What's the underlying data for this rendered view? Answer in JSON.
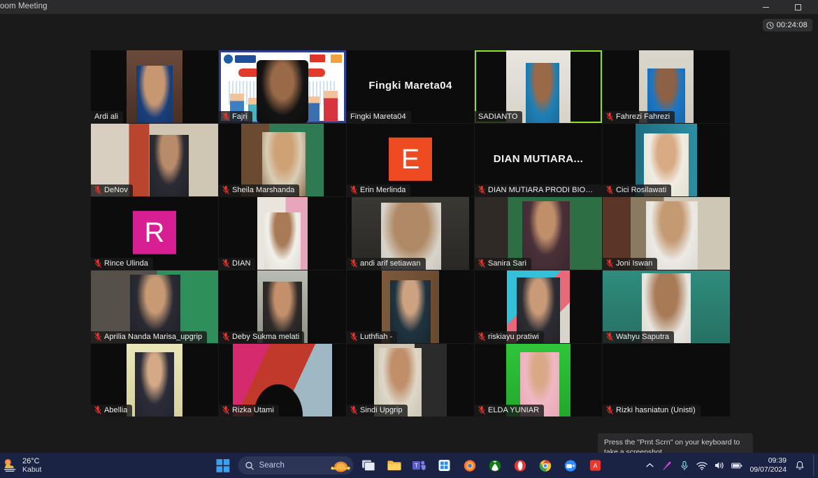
{
  "window": {
    "title": "oom Meeting",
    "minimize_label": "–",
    "maximize_label": "❐"
  },
  "meeting": {
    "timer": "00:24:08",
    "timer_icon": "clock-icon",
    "tooltip": "Press the \"Prnt Scrn\" on your keyboard to take a screenshot"
  },
  "participants": [
    {
      "name": "Ardi ali",
      "muted": false,
      "speaking": false,
      "kind": "video",
      "style": "p-ardi"
    },
    {
      "name": "Fajri",
      "muted": true,
      "speaking": false,
      "kind": "video",
      "style": "p-fajri"
    },
    {
      "name": "Fingki Mareta04",
      "muted": false,
      "speaking": false,
      "kind": "name",
      "display": "Fingki Mareta04"
    },
    {
      "name": "SADIANTO",
      "muted": false,
      "speaking": true,
      "kind": "video",
      "style": "p-sadianto"
    },
    {
      "name": "Fahrezi Fahrezi",
      "muted": true,
      "speaking": false,
      "kind": "video",
      "style": "p-fahrezi"
    },
    {
      "name": "DeNov",
      "muted": true,
      "speaking": false,
      "kind": "video",
      "style": "p-denov"
    },
    {
      "name": "Sheila Marshanda",
      "muted": true,
      "speaking": false,
      "kind": "video",
      "style": "p-sheila"
    },
    {
      "name": "Erin Merlinda",
      "muted": true,
      "speaking": false,
      "kind": "avatar",
      "letter": "E",
      "color": "#ee4b22"
    },
    {
      "name": "DIAN MUTIARA PRODI BIOLOGI F...",
      "muted": true,
      "speaking": false,
      "kind": "name",
      "display": "DIAN  MUTIARA..."
    },
    {
      "name": "Cici Rosilawati",
      "muted": true,
      "speaking": false,
      "kind": "video",
      "style": "p-cici"
    },
    {
      "name": "Rince Ulinda",
      "muted": true,
      "speaking": false,
      "kind": "avatar",
      "letter": "R",
      "color": "#d71f93"
    },
    {
      "name": "DIAN",
      "muted": true,
      "speaking": false,
      "kind": "video",
      "style": "p-dian"
    },
    {
      "name": "andi arif setiawan",
      "muted": true,
      "speaking": false,
      "kind": "video",
      "style": "p-andi"
    },
    {
      "name": "Sanira Sari",
      "muted": true,
      "speaking": false,
      "kind": "video",
      "style": "p-sanira"
    },
    {
      "name": "Joni Iswan",
      "muted": true,
      "speaking": false,
      "kind": "video",
      "style": "p-joni"
    },
    {
      "name": "Aprilia Nanda Marisa_upgrip",
      "muted": true,
      "speaking": false,
      "kind": "video",
      "style": "p-aprilia"
    },
    {
      "name": "Deby Sukma melati",
      "muted": true,
      "speaking": false,
      "kind": "video",
      "style": "p-deby"
    },
    {
      "name": "Luthfiah -",
      "muted": true,
      "speaking": false,
      "kind": "video",
      "style": "p-luthfiah"
    },
    {
      "name": "riskiayu pratiwi",
      "muted": true,
      "speaking": false,
      "kind": "video",
      "style": "p-riskiayu"
    },
    {
      "name": "Wahyu Saputra",
      "muted": true,
      "speaking": false,
      "kind": "video",
      "style": "p-wahyu"
    },
    {
      "name": "Abellia",
      "muted": true,
      "speaking": false,
      "kind": "video",
      "style": "p-abellia"
    },
    {
      "name": "Rizka Utami",
      "muted": true,
      "speaking": false,
      "kind": "video",
      "style": "p-rizka"
    },
    {
      "name": "Sindi Upgrip",
      "muted": true,
      "speaking": false,
      "kind": "video",
      "style": "p-sindi"
    },
    {
      "name": "ELDA YUNIAR",
      "muted": true,
      "speaking": false,
      "kind": "video",
      "style": "p-elda"
    },
    {
      "name": "Rizki hasniatun (Unisti)",
      "muted": true,
      "speaking": false,
      "kind": "blank"
    }
  ],
  "taskbar": {
    "weather": {
      "temp": "26°C",
      "desc": "Kabut",
      "icon": "weather-fog-icon"
    },
    "start_icon": "windows-start-icon",
    "search_placeholder": "Search",
    "search_icon": "search-icon",
    "pinned": [
      {
        "name": "task-view-icon"
      },
      {
        "name": "file-explorer-icon"
      },
      {
        "name": "microsoft-teams-icon"
      },
      {
        "name": "microsoft-store-icon"
      },
      {
        "name": "firefox-icon"
      },
      {
        "name": "xbox-icon"
      },
      {
        "name": "opera-icon"
      },
      {
        "name": "chrome-icon"
      },
      {
        "name": "zoom-icon"
      },
      {
        "name": "pdf-reader-icon"
      }
    ],
    "tray": [
      {
        "name": "show-hidden-icons-chevron"
      },
      {
        "name": "snipping-tool-icon"
      },
      {
        "name": "microphone-icon"
      },
      {
        "name": "wifi-icon"
      },
      {
        "name": "volume-icon"
      },
      {
        "name": "battery-icon"
      }
    ],
    "clock": {
      "time": "09:39",
      "date": "09/07/2024"
    },
    "notification_icon": "notification-bell-icon",
    "desktop_peek": "show-desktop-button"
  },
  "colors": {
    "speaking_border": "#8ee02b",
    "mute_icon": "#e8342a",
    "taskbar_bg": "#1b2344",
    "accent_blue": "#2b8ce5"
  }
}
